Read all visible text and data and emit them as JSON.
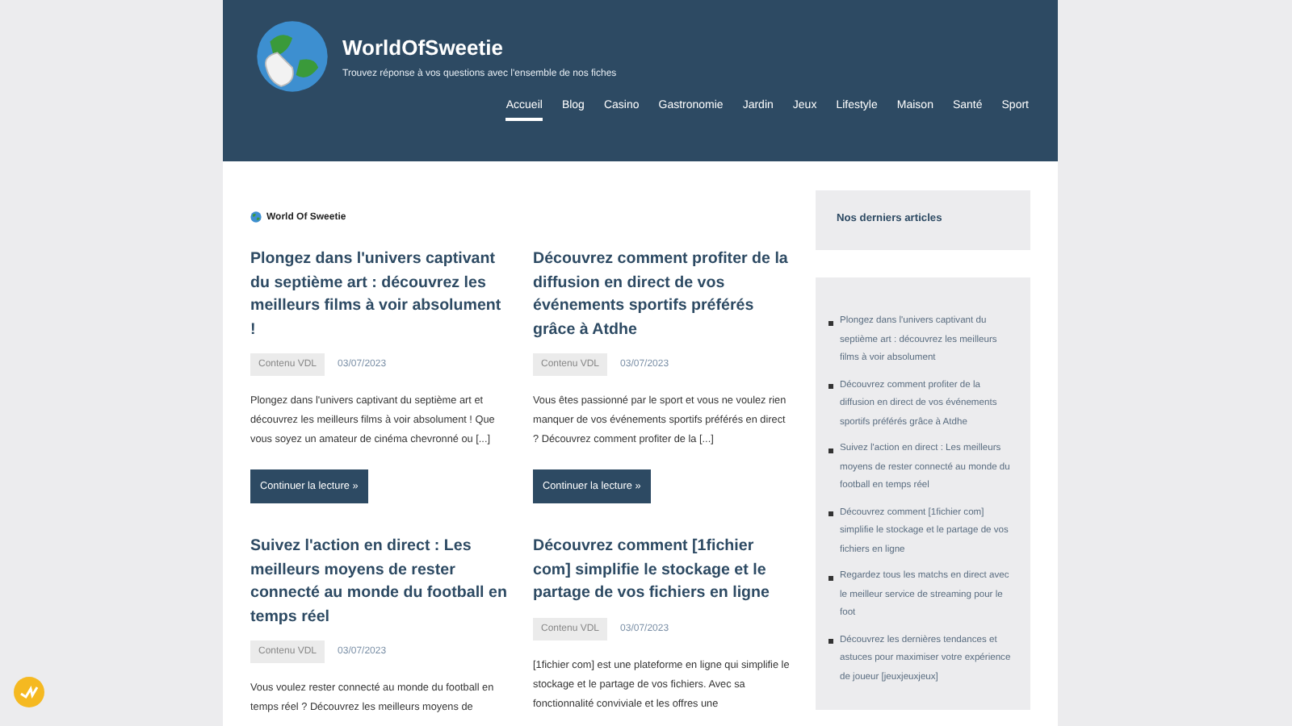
{
  "site": {
    "title": "WorldOfSweetie",
    "tagline": "Trouvez réponse à vos questions avec l'ensemble de nos fiches"
  },
  "nav": [
    {
      "label": "Accueil",
      "selected": true
    },
    {
      "label": "Blog",
      "selected": false
    },
    {
      "label": "Casino",
      "selected": false
    },
    {
      "label": "Gastronomie",
      "selected": false
    },
    {
      "label": "Jardin",
      "selected": false
    },
    {
      "label": "Jeux",
      "selected": false
    },
    {
      "label": "Lifestyle",
      "selected": false
    },
    {
      "label": "Maison",
      "selected": false
    },
    {
      "label": "Santé",
      "selected": false
    },
    {
      "label": "Sport",
      "selected": false
    }
  ],
  "breadcrumb": "World Of Sweetie",
  "posts": [
    {
      "title": "Plongez dans l'univers captivant du septième art : découvrez les meilleurs films à voir absolument !",
      "category": "Contenu VDL",
      "date": "03/07/2023",
      "excerpt": "Plongez dans l'univers captivant du septième art et découvrez les meilleurs films à voir absolument ! Que vous soyez un amateur de cinéma chevronné ou [...]",
      "button": "Continuer la lecture »"
    },
    {
      "title": "Découvrez comment profiter de la diffusion en direct de vos événements sportifs préférés grâce à Atdhe",
      "category": "Contenu VDL",
      "date": "03/07/2023",
      "excerpt": "Vous êtes passionné par le sport et vous ne voulez rien manquer de vos événements sportifs préférés en direct ? Découvrez comment profiter de la [...]",
      "button": "Continuer la lecture »"
    },
    {
      "title": "Suivez l'action en direct : Les meilleurs moyens de rester connecté au monde du football en temps réel",
      "category": "Contenu VDL",
      "date": "03/07/2023",
      "excerpt": "Vous voulez rester connecté au monde du football en temps réel ? Découvrez les meilleurs moyens de"
    },
    {
      "title": "Découvrez comment [1fichier com] simplifie le stockage et le partage de vos fichiers en ligne",
      "category": "Contenu VDL",
      "date": "03/07/2023",
      "excerpt": "[1fichier com] est une plateforme en ligne qui simplifie le stockage et le partage de vos fichiers. Avec sa fonctionnalité conviviale et les offres une"
    }
  ],
  "sidebar": {
    "heading": "Nos derniers articles",
    "items": [
      "Plongez dans l'univers captivant du septième art : découvrez les meilleurs films à voir absolument",
      "Découvrez comment profiter de la diffusion en direct de vos événements sportifs préférés grâce à Atdhe",
      "Suivez l'action en direct : Les meilleurs moyens de rester connecté au monde du football en temps réel",
      "Découvrez comment [1fichier com] simplifie le stockage et le partage de vos fichiers en ligne",
      "Regardez tous les matchs en direct avec le meilleur service de streaming pour le foot",
      "Découvrez les dernières tendances et astuces pour maximiser votre expérience de joueur [jeuxjeuxjeux]"
    ]
  }
}
